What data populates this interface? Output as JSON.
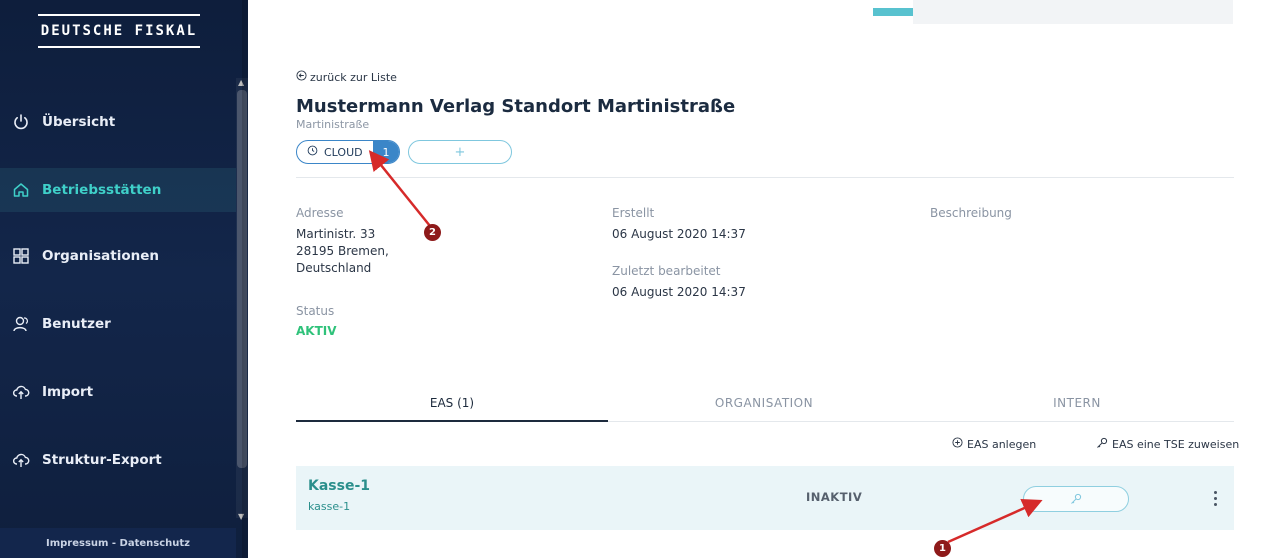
{
  "brand": "DEUTSCHE FISKAL",
  "sidebar": {
    "items": [
      {
        "label": "Übersicht",
        "icon": "power-icon"
      },
      {
        "label": "Betriebsstätten",
        "icon": "home-icon"
      },
      {
        "label": "Organisationen",
        "icon": "grid-icon"
      },
      {
        "label": "Benutzer",
        "icon": "users-icon"
      },
      {
        "label": "Import",
        "icon": "cloud-upload-icon"
      },
      {
        "label": "Struktur-Export",
        "icon": "cloud-upload-icon"
      }
    ],
    "footer": "Impressum - Datenschutz"
  },
  "main": {
    "back_link": "zurück zur Liste",
    "title": "Mustermann Verlag Standort Martinistraße",
    "subtitle": "Martinistraße",
    "cloud_pill": {
      "label": "CLOUD",
      "count": "1"
    },
    "add_pill": "+",
    "info": {
      "address_label": "Adresse",
      "address_line1": "Martinistr. 33",
      "address_line2": "28195 Bremen,",
      "address_line3": "Deutschland",
      "status_label": "Status",
      "status_value": "AKTIV",
      "created_label": "Erstellt",
      "created_value": "06 August 2020 14:37",
      "edited_label": "Zuletzt bearbeitet",
      "edited_value": "06 August 2020 14:37",
      "description_label": "Beschreibung"
    },
    "tabs": [
      {
        "label": "EAS (1)"
      },
      {
        "label": "ORGANISATION"
      },
      {
        "label": "INTERN"
      }
    ],
    "actions": {
      "create": "EAS anlegen",
      "assign": "EAS eine TSE zuweisen"
    },
    "row": {
      "name": "Kasse-1",
      "id": "kasse-1",
      "status": "INAKTIV"
    }
  },
  "annotations": {
    "badge1": "1",
    "badge2": "2"
  },
  "colors": {
    "sidebar_bg": "#0e1e3c",
    "active_teal": "#3fd0c9",
    "accent_blue": "#3b86c8",
    "status_green": "#2fc27a",
    "annotation_red": "#d62a2a"
  }
}
